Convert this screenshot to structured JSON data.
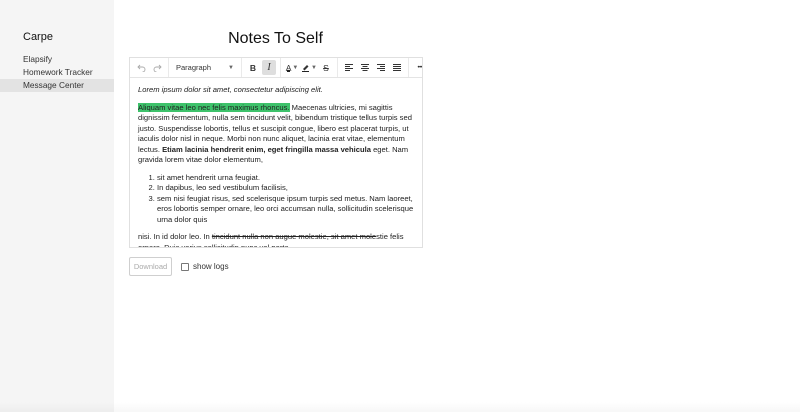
{
  "sidebar": {
    "brand": "Carpe",
    "items": [
      {
        "label": "Elapsify",
        "active": false
      },
      {
        "label": "Homework Tracker",
        "active": false
      },
      {
        "label": "Message Center",
        "active": true
      }
    ]
  },
  "page": {
    "title": "Notes To Self"
  },
  "toolbar": {
    "undo_icon": "undo-icon",
    "redo_icon": "redo-icon",
    "block_format": "Paragraph",
    "bold": "B",
    "italic": "I",
    "text_color": "A",
    "strikethrough": "S",
    "more": "•••"
  },
  "editor": {
    "intro": "Lorem ipsum dolor sit amet, consectetur adipiscing elit.",
    "highlighted": "Aliquam vitae leo nec felis maximus rhoncus.",
    "para1_rest": " Maecenas ultricies, mi sagittis dignissim fermentum, nulla sem tincidunt velit, bibendum tristique tellus turpis sed justo. Suspendisse lobortis, tellus et suscipit congue, libero est placerat turpis, ut iaculis dolor nisl in neque. Morbi non nunc aliquet, lacinia erat vitae, elementum lectus. ",
    "para1_bold": "Etiam lacinia hendrerit enim, eget fringilla massa vehicula",
    "para1_end": " eget. Nam gravida lorem vitae dolor elementum,",
    "list": [
      "sit amet hendrerit urna feugiat.",
      "In dapibus, leo sed vestibulum facilisis,",
      "sem nisi feugiat risus, sed scelerisque ipsum turpis sed metus. Nam laoreet, eros lobortis semper ornare, leo orci accumsan nulla, sollicitudin scelerisque urna dolor quis"
    ],
    "last_start": "nisi. In id dolor leo. In ",
    "last_strike": "tincidunt nulla non augue molestie, sit amet mole",
    "last_end": "stie felis ornare. Duis varius sollicitudin nunc vel porta."
  },
  "controls": {
    "download_label": "Download",
    "show_logs_label": "show logs",
    "show_logs_checked": false
  },
  "colors": {
    "highlight": "#3ec26b",
    "sidebar_bg": "#f5f5f5",
    "active_item_bg": "#e3e3e3"
  }
}
